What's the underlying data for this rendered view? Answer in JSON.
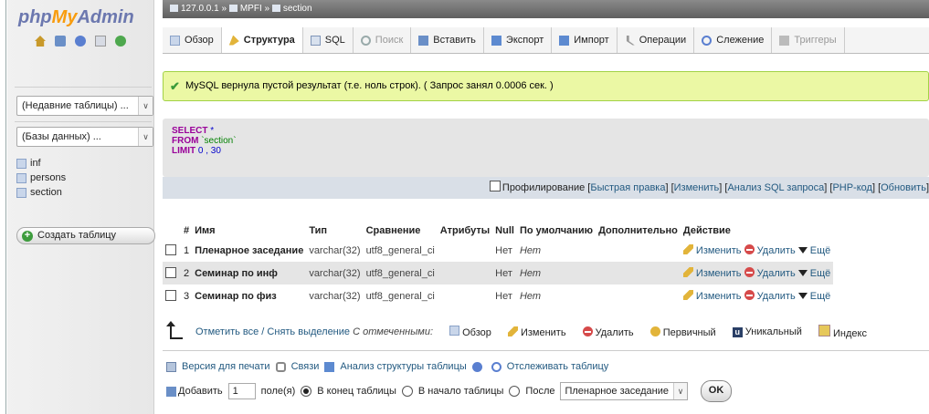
{
  "sidebar": {
    "logo": {
      "php": "php",
      "my": "My",
      "admin": "Admin"
    },
    "recent_select": "(Недавние таблицы) ...",
    "db_select": "(Базы данных) ...",
    "tables": [
      {
        "name": "inf"
      },
      {
        "name": "persons"
      },
      {
        "name": "section"
      }
    ],
    "create_table": "Создать таблицу"
  },
  "breadcrumb": {
    "server": "127.0.0.1",
    "db": "MPFI",
    "table": "section",
    "sep": "»"
  },
  "tabs": [
    {
      "label": "Обзор",
      "state": "normal"
    },
    {
      "label": "Структура",
      "state": "active"
    },
    {
      "label": "SQL",
      "state": "normal"
    },
    {
      "label": "Поиск",
      "state": "disabled"
    },
    {
      "label": "Вставить",
      "state": "normal"
    },
    {
      "label": "Экспорт",
      "state": "normal"
    },
    {
      "label": "Импорт",
      "state": "normal"
    },
    {
      "label": "Операции",
      "state": "normal"
    },
    {
      "label": "Слежение",
      "state": "normal"
    },
    {
      "label": "Триггеры",
      "state": "disabled"
    }
  ],
  "message": "MySQL вернула пустой результат (т.е. ноль строк). ( Запрос занял 0.0006 сек. )",
  "query": {
    "select": "SELECT",
    "star": " *",
    "from": "FROM",
    "table": " `section`",
    "limit": "LIMIT",
    "limit_val": " 0 , 30"
  },
  "profiling": {
    "label": "Профилирование",
    "links": [
      "Быстрая правка",
      "Изменить",
      "Анализ SQL запроса",
      "PHP-код",
      "Обновить"
    ]
  },
  "columns_header": [
    "#",
    "Имя",
    "Тип",
    "Сравнение",
    "Атрибуты",
    "Null",
    "По умолчанию",
    "Дополнительно",
    "Действие"
  ],
  "rows": [
    {
      "num": "1",
      "name": "Пленарное заседание",
      "type": "varchar(32)",
      "collation": "utf8_general_ci",
      "attributes": "",
      "null": "Нет",
      "default": "Нет",
      "extra": ""
    },
    {
      "num": "2",
      "name": "Семинар по инф",
      "type": "varchar(32)",
      "collation": "utf8_general_ci",
      "attributes": "",
      "null": "Нет",
      "default": "Нет",
      "extra": ""
    },
    {
      "num": "3",
      "name": "Семинар по физ",
      "type": "varchar(32)",
      "collation": "utf8_general_ci",
      "attributes": "",
      "null": "Нет",
      "default": "Нет",
      "extra": ""
    }
  ],
  "row_actions": {
    "edit": "Изменить",
    "delete": "Удалить",
    "more": "Ещё"
  },
  "bulk": {
    "check_all": "Отметить все / Снять выделение",
    "with_selected": "С отмеченными:",
    "browse": "Обзор",
    "edit": "Изменить",
    "delete": "Удалить",
    "primary": "Первичный",
    "unique": "Уникальный",
    "index": "Индекс"
  },
  "bottom_links": {
    "print": "Версия для печати",
    "relations": "Связи",
    "analyze": "Анализ структуры таблицы",
    "track": "Отслеживать таблицу"
  },
  "add_fields": {
    "add": "Добавить",
    "count": "1",
    "fields_label": "поле(я)",
    "at_end": "В конец таблицы",
    "at_begin": "В начало таблицы",
    "after": "После",
    "after_field": "Пленарное заседание",
    "go": "OK"
  }
}
